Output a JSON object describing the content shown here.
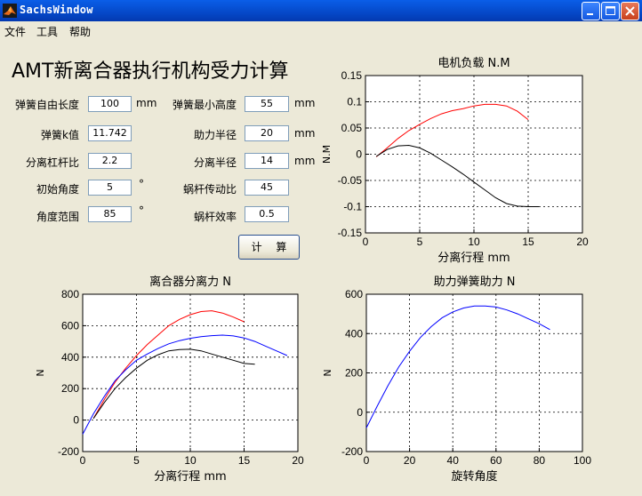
{
  "window": {
    "title": "SachsWindow"
  },
  "menu": [
    "文件",
    "工具",
    "帮助"
  ],
  "page_title": "AMT新离合器执行机构受力计算",
  "params": [
    {
      "label": "弹簧自由长度",
      "value": "100",
      "unit": "mm"
    },
    {
      "label": "弹簧k值",
      "value": "11.742",
      "unit": ""
    },
    {
      "label": "分离杠杆比",
      "value": "2.2",
      "unit": ""
    },
    {
      "label": "初始角度",
      "value": "5",
      "unit": "°"
    },
    {
      "label": "角度范围",
      "value": "85",
      "unit": "°"
    },
    {
      "label": "弹簧最小高度",
      "value": "55",
      "unit": "mm"
    },
    {
      "label": "助力半径",
      "value": "20",
      "unit": "mm"
    },
    {
      "label": "分离半径",
      "value": "14",
      "unit": "mm"
    },
    {
      "label": "蜗杆传动比",
      "value": "45",
      "unit": ""
    },
    {
      "label": "蜗杆效率",
      "value": "0.5",
      "unit": ""
    }
  ],
  "calc_button": "计 算",
  "colors": {
    "red": "#ff0000",
    "blue": "#0000ff",
    "black": "#000000"
  },
  "chart_data": [
    {
      "type": "line",
      "title": "电机负载 N.M",
      "xlabel": "分离行程 mm",
      "ylabel": "N.M",
      "xlim": [
        0,
        20
      ],
      "ylim": [
        -0.15,
        0.15
      ],
      "xticks": [
        "0",
        "5",
        "10",
        "15",
        "20"
      ],
      "yticks": [
        "0.15",
        "0.1",
        "0.05",
        "0",
        "-0.05",
        "-0.1",
        "-0.15"
      ],
      "grid": true,
      "series": [
        {
          "color": "red",
          "x": [
            1,
            2,
            3,
            4,
            5,
            6,
            7,
            8,
            9,
            10,
            11,
            12,
            13,
            14,
            15
          ],
          "y": [
            -0.005,
            0.012,
            0.03,
            0.045,
            0.057,
            0.068,
            0.077,
            0.083,
            0.087,
            0.092,
            0.095,
            0.095,
            0.092,
            0.082,
            0.066
          ]
        },
        {
          "color": "black",
          "x": [
            1,
            2,
            3,
            4,
            5,
            6,
            7,
            8,
            9,
            10,
            11,
            12,
            13,
            14,
            15,
            16
          ],
          "y": [
            -0.004,
            0.009,
            0.016,
            0.017,
            0.012,
            0.002,
            -0.011,
            -0.024,
            -0.038,
            -0.053,
            -0.068,
            -0.083,
            -0.094,
            -0.099,
            -0.1,
            -0.1
          ]
        }
      ]
    },
    {
      "type": "line",
      "title": "离合器分离力 N",
      "xlabel": "分离行程 mm",
      "ylabel": "N",
      "xlim": [
        0,
        20
      ],
      "ylim": [
        -200,
        800
      ],
      "xticks": [
        "0",
        "5",
        "10",
        "15",
        "20"
      ],
      "yticks": [
        "800",
        "600",
        "400",
        "200",
        "0",
        "-200"
      ],
      "grid": true,
      "series": [
        {
          "color": "red",
          "x": [
            1,
            2,
            3,
            4,
            5,
            6,
            7,
            8,
            9,
            10,
            11,
            12,
            13,
            14,
            15
          ],
          "y": [
            10,
            130,
            240,
            330,
            410,
            480,
            540,
            600,
            640,
            670,
            690,
            695,
            680,
            655,
            625
          ]
        },
        {
          "color": "blue",
          "x": [
            0,
            1,
            2,
            3,
            4,
            5,
            6,
            7,
            8,
            9,
            10,
            11,
            12,
            13,
            14,
            15,
            16,
            17,
            18,
            19
          ],
          "y": [
            -90,
            40,
            150,
            250,
            320,
            380,
            420,
            455,
            485,
            505,
            520,
            530,
            537,
            540,
            535,
            522,
            500,
            470,
            440,
            410
          ]
        },
        {
          "color": "black",
          "x": [
            1,
            2,
            3,
            4,
            5,
            6,
            7,
            8,
            9,
            10,
            11,
            12,
            13,
            14,
            15,
            16
          ],
          "y": [
            10,
            110,
            200,
            270,
            330,
            380,
            415,
            440,
            448,
            450,
            440,
            420,
            400,
            380,
            360,
            355
          ]
        }
      ]
    },
    {
      "type": "line",
      "title": "助力弹簧助力 N",
      "xlabel": "旋转角度",
      "ylabel": "N",
      "xlim": [
        0,
        100
      ],
      "ylim": [
        -200,
        600
      ],
      "xticks": [
        "0",
        "20",
        "40",
        "60",
        "80",
        "100"
      ],
      "yticks": [
        "600",
        "400",
        "200",
        "0",
        "-200"
      ],
      "grid": true,
      "series": [
        {
          "color": "blue",
          "x": [
            0,
            5,
            10,
            15,
            20,
            25,
            30,
            35,
            40,
            45,
            50,
            55,
            60,
            65,
            70,
            75,
            80,
            85
          ],
          "y": [
            -80,
            30,
            135,
            230,
            310,
            380,
            435,
            480,
            510,
            530,
            540,
            540,
            535,
            520,
            500,
            475,
            450,
            420
          ]
        }
      ]
    }
  ]
}
